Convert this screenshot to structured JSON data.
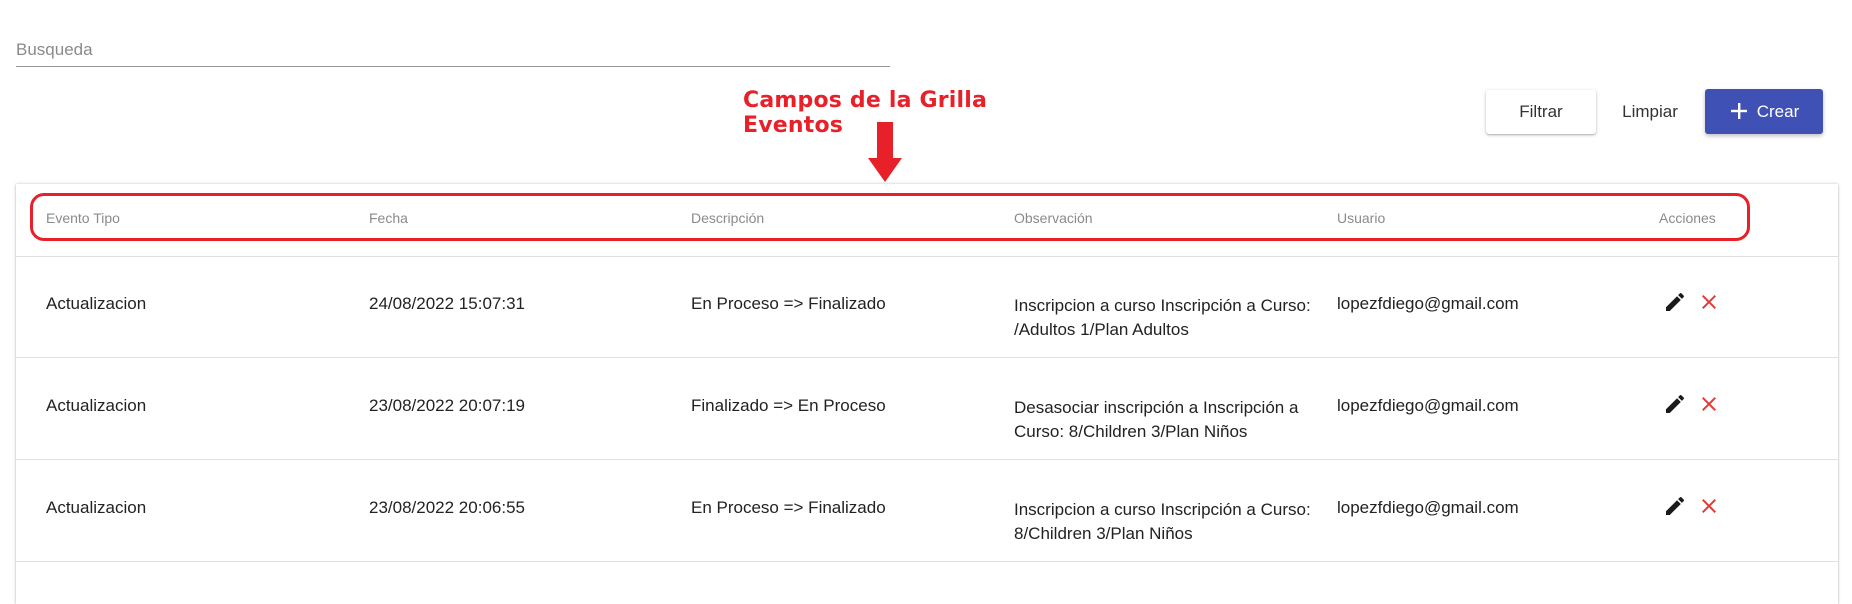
{
  "search": {
    "placeholder": "Busqueda",
    "value": ""
  },
  "annotation": {
    "title": "Campos de la Grilla Eventos",
    "color": "#e8202a"
  },
  "toolbar": {
    "filtrar_label": "Filtrar",
    "limpiar_label": "Limpiar",
    "crear_label": "Crear",
    "crear_icon": "plus-icon",
    "accent_color": "#3f51b5"
  },
  "table": {
    "columns": [
      "Evento Tipo",
      "Fecha",
      "Descripción",
      "Observación",
      "Usuario",
      "Acciones"
    ],
    "rows": [
      {
        "tipo": "Actualizacion",
        "fecha": "24/08/2022 15:07:31",
        "descripcion": "En Proceso => Finalizado",
        "observacion_l1": "Inscripcion a curso Inscripción a Curso:",
        "observacion_l2": "/Adultos 1/Plan Adultos",
        "usuario": "lopezfdiego@gmail.com"
      },
      {
        "tipo": "Actualizacion",
        "fecha": "23/08/2022 20:07:19",
        "descripcion": "Finalizado => En Proceso",
        "observacion_l1": "Desasociar inscripción a Inscripción a",
        "observacion_l2": "Curso: 8/Children 3/Plan Niños",
        "usuario": "lopezfdiego@gmail.com"
      },
      {
        "tipo": "Actualizacion",
        "fecha": "23/08/2022 20:06:55",
        "descripcion": "En Proceso => Finalizado",
        "observacion_l1": "Inscripcion a curso Inscripción a Curso:",
        "observacion_l2": "8/Children 3/Plan Niños",
        "usuario": "lopezfdiego@gmail.com"
      }
    ],
    "row_action_icons": [
      "edit-icon",
      "delete-icon"
    ],
    "delete_color": "#e53935"
  }
}
